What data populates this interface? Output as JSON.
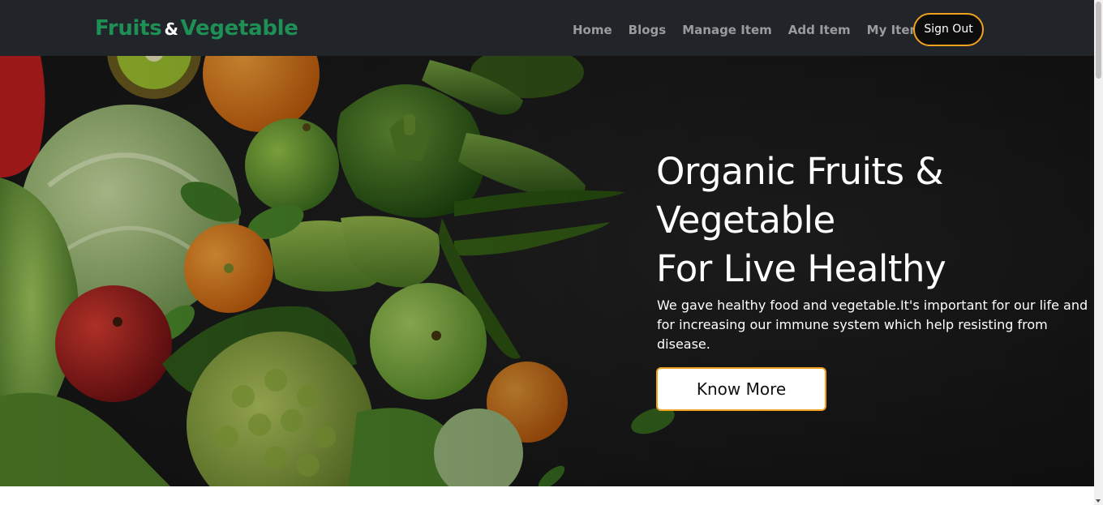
{
  "brand": {
    "part1": "Fruits",
    "amp": "&",
    "part2": "Vegetable"
  },
  "nav": {
    "items": [
      "Home",
      "Blogs",
      "Manage Item",
      "Add Item",
      "My Item"
    ],
    "sign_out": "Sign Out"
  },
  "hero": {
    "title_line1": "Organic Fruits &",
    "title_line2": "Vegetable",
    "title_line3": "For Live Healthy",
    "subtitle": "We gave healthy food and vegetable.It's important for our life and for increasing our immune system which help resisting from disease.",
    "button_label": "Know More"
  },
  "colors": {
    "navbar_bg": "#212529",
    "brand_green": "#1e8f55",
    "accent_orange": "#f0a21c",
    "nav_text": "#9a9b9d"
  }
}
